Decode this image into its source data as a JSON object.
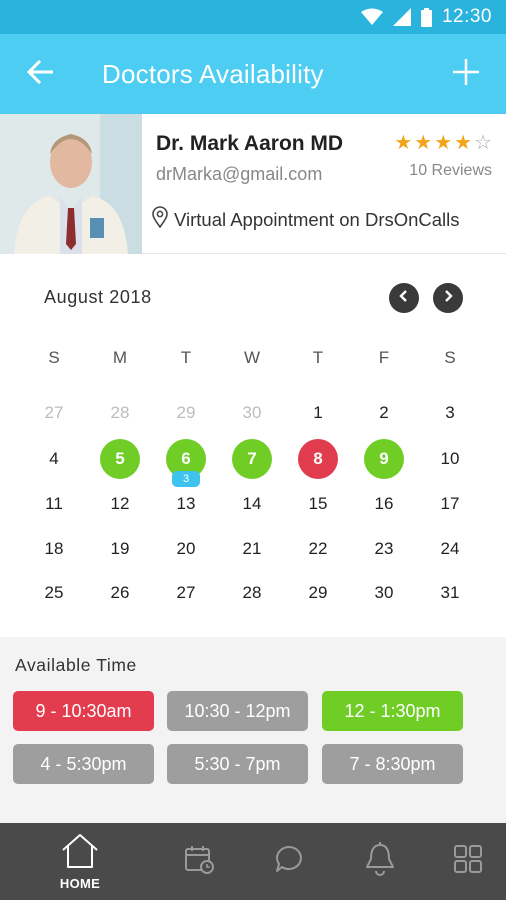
{
  "status_bar": {
    "time": "12:30"
  },
  "app_bar": {
    "title": "Doctors Availability"
  },
  "doctor": {
    "name": "Dr. Mark Aaron MD",
    "email": "drMarka@gmail.com",
    "rating": 4,
    "rating_max": 5,
    "reviews": "10 Reviews",
    "location": "Virtual Appointment on DrsOnCalls"
  },
  "calendar": {
    "month": "August 2018",
    "weekdays": [
      "S",
      "M",
      "T",
      "W",
      "T",
      "F",
      "S"
    ],
    "weeks": [
      [
        {
          "d": "27",
          "s": "other"
        },
        {
          "d": "28",
          "s": "other"
        },
        {
          "d": "29",
          "s": "other"
        },
        {
          "d": "30",
          "s": "other"
        },
        {
          "d": "1",
          "s": ""
        },
        {
          "d": "2",
          "s": ""
        },
        {
          "d": "3",
          "s": ""
        }
      ],
      [
        {
          "d": "4",
          "s": ""
        },
        {
          "d": "5",
          "s": "available"
        },
        {
          "d": "6",
          "s": "available",
          "badge": "3"
        },
        {
          "d": "7",
          "s": "available"
        },
        {
          "d": "8",
          "s": "booked"
        },
        {
          "d": "9",
          "s": "available"
        },
        {
          "d": "10",
          "s": ""
        }
      ],
      [
        {
          "d": "11",
          "s": ""
        },
        {
          "d": "12",
          "s": ""
        },
        {
          "d": "13",
          "s": ""
        },
        {
          "d": "14",
          "s": ""
        },
        {
          "d": "15",
          "s": ""
        },
        {
          "d": "16",
          "s": ""
        },
        {
          "d": "17",
          "s": ""
        }
      ],
      [
        {
          "d": "18",
          "s": ""
        },
        {
          "d": "19",
          "s": ""
        },
        {
          "d": "20",
          "s": ""
        },
        {
          "d": "21",
          "s": ""
        },
        {
          "d": "22",
          "s": ""
        },
        {
          "d": "23",
          "s": ""
        },
        {
          "d": "24",
          "s": ""
        }
      ],
      [
        {
          "d": "25",
          "s": ""
        },
        {
          "d": "26",
          "s": ""
        },
        {
          "d": "27",
          "s": ""
        },
        {
          "d": "28",
          "s": ""
        },
        {
          "d": "29",
          "s": ""
        },
        {
          "d": "30",
          "s": ""
        },
        {
          "d": "31",
          "s": ""
        }
      ]
    ]
  },
  "available_time": {
    "title": "Available Time",
    "slots": [
      {
        "label": "9 - 10:30am",
        "state": "booked"
      },
      {
        "label": "10:30 - 12pm",
        "state": "taken"
      },
      {
        "label": "12 - 1:30pm",
        "state": "open"
      },
      {
        "label": "4 - 5:30pm",
        "state": "taken"
      },
      {
        "label": "5:30 - 7pm",
        "state": "taken"
      },
      {
        "label": "7 - 8:30pm",
        "state": "taken"
      }
    ]
  },
  "bottom_nav": {
    "items": [
      {
        "label": "HOME",
        "icon": "home-icon"
      },
      {
        "label": "",
        "icon": "calendar-clock-icon"
      },
      {
        "label": "",
        "icon": "chat-icon"
      },
      {
        "label": "",
        "icon": "bell-icon"
      },
      {
        "label": "",
        "icon": "grid-icon"
      }
    ]
  },
  "colors": {
    "status_bar": "#2ab3dd",
    "app_bar": "#4dcdf2",
    "available": "#6fcd25",
    "booked": "#e13c4e",
    "taken": "#9e9e9e",
    "star": "#f2a51b",
    "badge": "#3ec3ef",
    "bottom_nav": "#4a4a4a"
  }
}
